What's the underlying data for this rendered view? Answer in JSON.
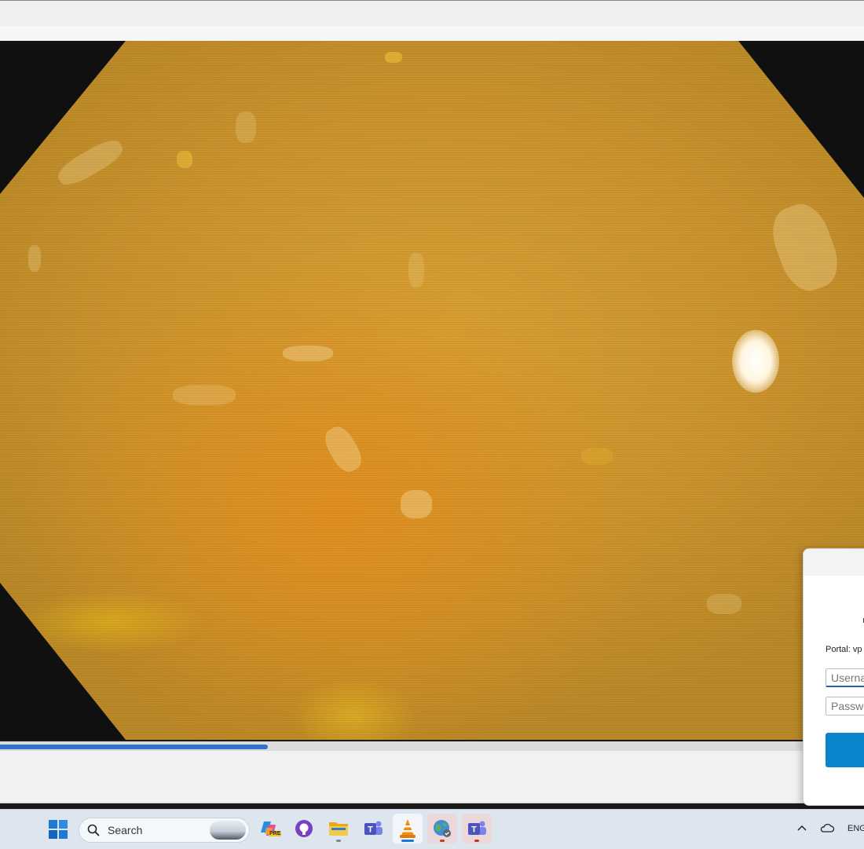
{
  "dialog": {
    "portal_label": "Portal: vp",
    "username_placeholder": "Userna",
    "password_placeholder": "Passwo"
  },
  "player": {
    "progress_fraction": 0.31
  },
  "taskbar": {
    "search_label": "Search",
    "language": "ENG",
    "apps": [
      {
        "icon": "copilot-icon",
        "badge": "PRE"
      },
      {
        "icon": "github-icon"
      },
      {
        "icon": "file-explorer-icon"
      },
      {
        "icon": "teams-icon"
      },
      {
        "icon": "vlc-icon"
      },
      {
        "icon": "globe-vpn-icon"
      },
      {
        "icon": "teams-icon"
      }
    ]
  },
  "colors": {
    "accent": "#2f74c8",
    "signin_button": "#0a84cc",
    "taskbar": "#dde6ef"
  }
}
